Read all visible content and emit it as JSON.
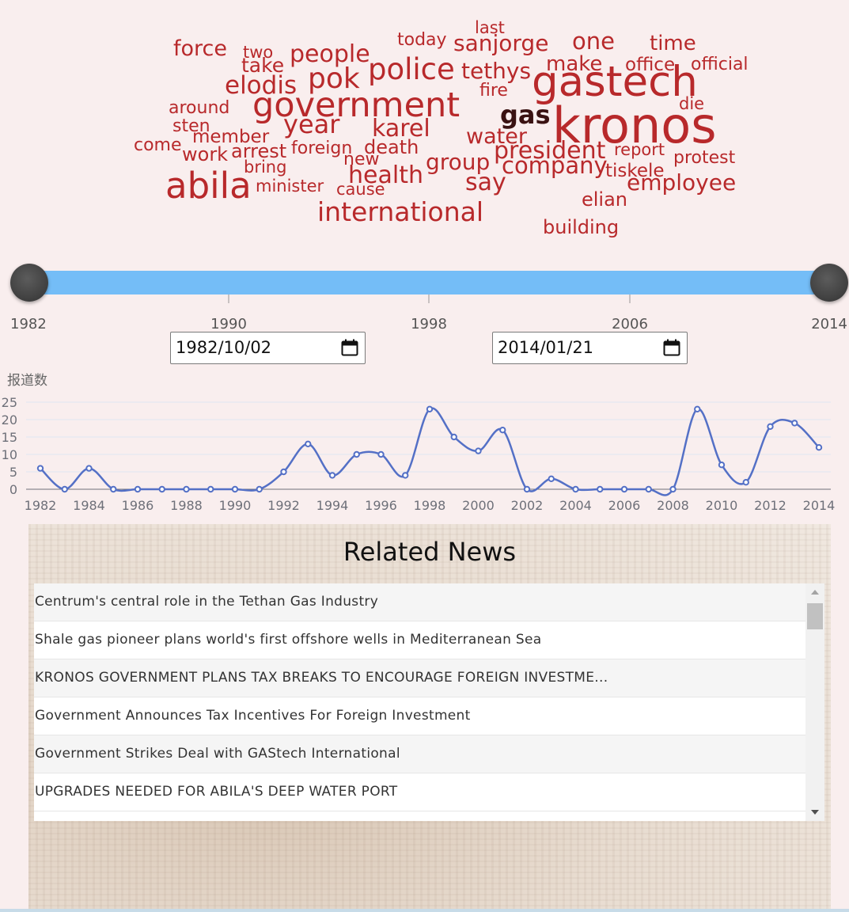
{
  "word_cloud": {
    "words": [
      "force",
      "two",
      "take",
      "people",
      "today",
      "last",
      "sanjorge",
      "one",
      "time",
      "make",
      "office",
      "official",
      "tethys",
      "police",
      "pok",
      "elodis",
      "gastech",
      "fire",
      "around",
      "government",
      "die",
      "gas",
      "kronos",
      "sten",
      "year",
      "karel",
      "member",
      "water",
      "come",
      "work",
      "arrest",
      "foreign",
      "death",
      "president",
      "report",
      "protest",
      "bring",
      "new",
      "group",
      "company",
      "tiskele",
      "abila",
      "minister",
      "health",
      "cause",
      "say",
      "employee",
      "elian",
      "international",
      "building"
    ],
    "accent_color": "#b8292b",
    "highlight_color": "#3a1212"
  },
  "range_slider": {
    "tick_labels": [
      "1982",
      "1990",
      "1998",
      "2006",
      "2014"
    ],
    "track_color": "#74bdf7",
    "start": "1982",
    "end": "2014"
  },
  "date_range": {
    "start_value": "1982/10/02",
    "end_value": "2014/01/21"
  },
  "chart": {
    "ylabel": "报道数"
  },
  "chart_data": {
    "type": "line",
    "ylabel": "报道数",
    "ylim": [
      0,
      25
    ],
    "yticks": [
      0,
      5,
      10,
      15,
      20,
      25
    ],
    "xticks": [
      1982,
      1984,
      1986,
      1988,
      1990,
      1992,
      1994,
      1996,
      1998,
      2000,
      2002,
      2004,
      2006,
      2008,
      2010,
      2012,
      2014
    ],
    "smooth": true,
    "grid": true,
    "series": [
      {
        "color": "#5470c6",
        "x": [
          1982,
          1983,
          1984,
          1985,
          1986,
          1987,
          1988,
          1989,
          1990,
          1991,
          1992,
          1993,
          1994,
          1995,
          1996,
          1997,
          1998,
          1999,
          2000,
          2001,
          2002,
          2003,
          2004,
          2005,
          2006,
          2007,
          2008,
          2009,
          2010,
          2011,
          2012,
          2013,
          2014
        ],
        "values": [
          6,
          0,
          6,
          0,
          0,
          0,
          0,
          0,
          0,
          0,
          5,
          13,
          4,
          10,
          10,
          4,
          23,
          15,
          11,
          17,
          0,
          3,
          0,
          0,
          0,
          0,
          0,
          23,
          7,
          2,
          18,
          19,
          12
        ]
      }
    ]
  },
  "news": {
    "title": "Related News",
    "items": [
      "Centrum's central role in the Tethan Gas Industry",
      "Shale gas pioneer plans world's first offshore wells in Mediterranean Sea",
      "KRONOS GOVERNMENT PLANS TAX BREAKS TO ENCOURAGE FOREIGN INVESTME...",
      "Government Announces Tax Incentives For Foreign Investment",
      "Government Strikes Deal with GAStech International",
      "UPGRADES NEEDED FOR ABILA'S DEEP WATER PORT"
    ]
  }
}
